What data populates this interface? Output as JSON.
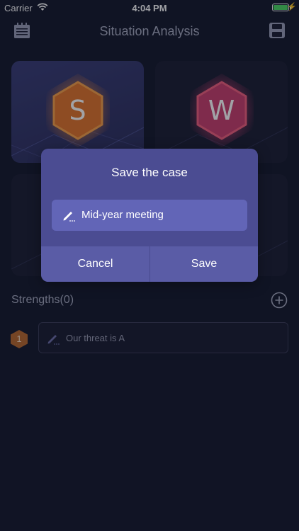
{
  "status_bar": {
    "carrier": "Carrier",
    "time": "4:04 PM",
    "battery_level": 1.0
  },
  "nav": {
    "title": "Situation Analysis",
    "left_icon": "calendar-icon",
    "right_icon": "floppy-save-icon"
  },
  "tiles": [
    {
      "letter": "S",
      "color": "#f08a3a",
      "selected": true
    },
    {
      "letter": "W",
      "color": "#e0457a",
      "selected": false
    },
    {
      "letter": "",
      "color": "#6a6fc0",
      "selected": false
    },
    {
      "letter": "",
      "color": "#6a6fc0",
      "selected": false
    }
  ],
  "section": {
    "label": "Strengths(0)",
    "add_icon": "plus-circle-icon"
  },
  "items": [
    {
      "number": "1",
      "placeholder": "Our threat is A",
      "badge_color": "#b8692f"
    }
  ],
  "dialog": {
    "title": "Save the case",
    "input_value": "Mid-year meeting",
    "cancel_label": "Cancel",
    "save_label": "Save"
  },
  "colors": {
    "background": "#161a2e",
    "dialog": "#4b4c92",
    "accent_orange": "#f08a3a",
    "accent_pink": "#e0457a"
  }
}
